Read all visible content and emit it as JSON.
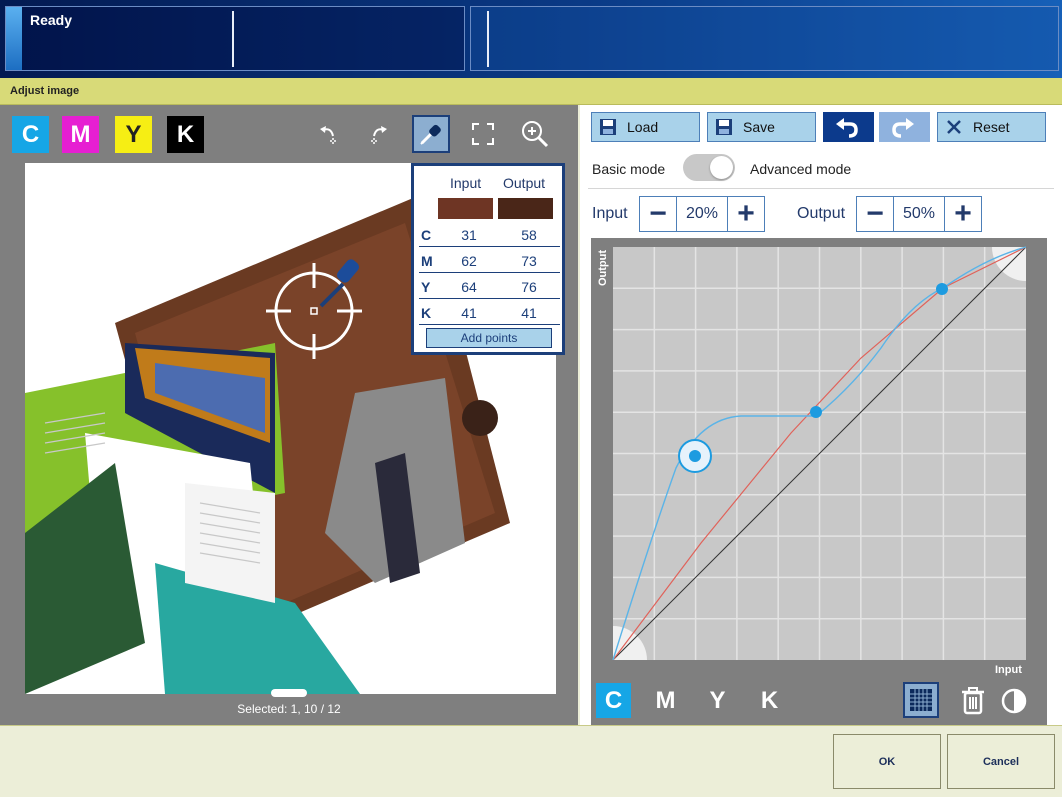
{
  "status": {
    "text": "Ready"
  },
  "window": {
    "title": "Adjust image"
  },
  "ink_buttons": [
    {
      "label": "C",
      "color": "#16a6e6"
    },
    {
      "label": "M",
      "color": "#e61fd2"
    },
    {
      "label": "Y",
      "color": "#f6ee14"
    },
    {
      "label": "K",
      "color": "#000000"
    }
  ],
  "preview": {
    "selected_text": "Selected: 1, 10 / 12"
  },
  "picker": {
    "input_header": "Input",
    "output_header": "Output",
    "input_swatch": "#6e3524",
    "output_swatch": "#4a2618",
    "rows": [
      {
        "label": "C",
        "input": "31",
        "output": "58"
      },
      {
        "label": "M",
        "input": "62",
        "output": "73"
      },
      {
        "label": "Y",
        "input": "64",
        "output": "76"
      },
      {
        "label": "K",
        "input": "41",
        "output": "41"
      }
    ],
    "add_points_label": "Add points"
  },
  "toolbar": {
    "load_label": "Load",
    "save_label": "Save",
    "reset_label": "Reset"
  },
  "mode": {
    "basic_label": "Basic mode",
    "advanced_label": "Advanced mode"
  },
  "steppers": {
    "input_label": "Input",
    "input_value": "20%",
    "output_label": "Output",
    "output_value": "50%"
  },
  "curve": {
    "axis_x_label": "Input",
    "axis_y_label": "Output"
  },
  "channels": [
    {
      "label": "C",
      "active": true
    },
    {
      "label": "M",
      "active": false
    },
    {
      "label": "Y",
      "active": false
    },
    {
      "label": "K",
      "active": false
    }
  ],
  "footer": {
    "ok_label": "OK",
    "cancel_label": "Cancel"
  }
}
